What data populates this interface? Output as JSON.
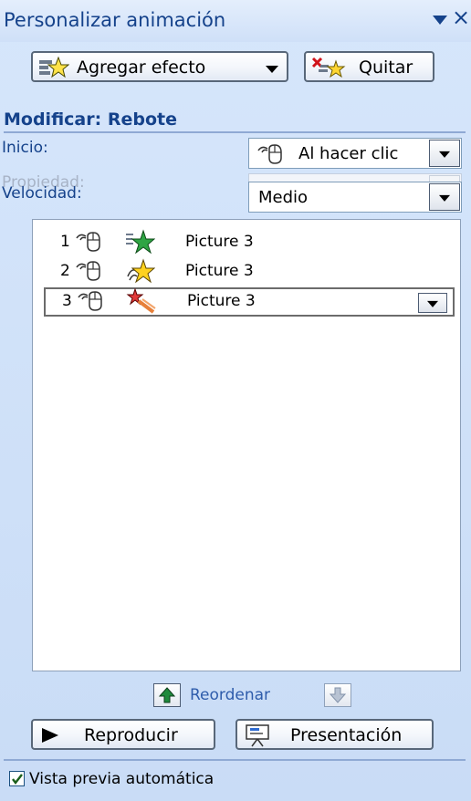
{
  "pane": {
    "title": "Personalizar animación",
    "pin_icon": "dropdown-triangle",
    "close_icon": "×"
  },
  "toolbar": {
    "add_effect_label": "Agregar efecto",
    "remove_label": "Quitar"
  },
  "modify": {
    "heading": "Modificar: Rebote",
    "start_label": "Inicio:",
    "start_value": "Al hacer clic",
    "property_label": "Propiedad:",
    "property_value": "",
    "speed_label": "Velocidad:",
    "speed_value": "Medio"
  },
  "effects_list": [
    {
      "number": "1",
      "trigger_icon": "mouse-click",
      "effect_icon": "green-star-entrance",
      "name": "Picture 3"
    },
    {
      "number": "2",
      "trigger_icon": "mouse-click",
      "effect_icon": "yellow-star-emphasis",
      "name": "Picture 3"
    },
    {
      "number": "3",
      "trigger_icon": "mouse-click",
      "effect_icon": "red-star-exit",
      "name": "Picture 3",
      "selected": true
    }
  ],
  "reorder": {
    "label": "Reordenar"
  },
  "footer": {
    "play_label": "Reproducir",
    "slideshow_label": "Presentación",
    "autopreview_label": "Vista previa automática",
    "autopreview_checked": true
  },
  "colors": {
    "accent": "#15428b",
    "pane_bg": "#d6e6fb",
    "link": "#2e5cab"
  }
}
